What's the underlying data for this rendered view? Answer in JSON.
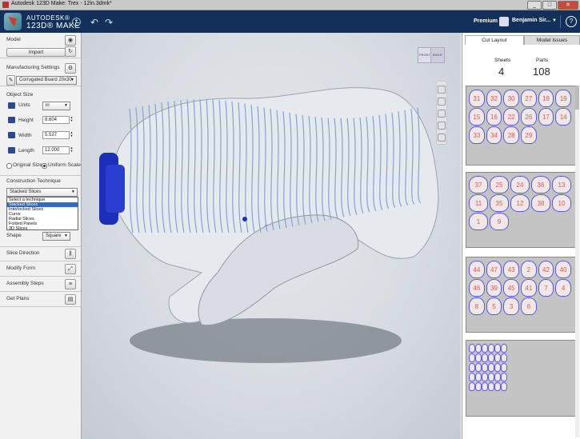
{
  "window": {
    "title": "Autodesk 123D Make: Trex - 12in.3dmk*",
    "buttons": [
      "_",
      "□",
      "✕"
    ]
  },
  "appbar": {
    "brand_line1": "AUTODESK®",
    "brand_line2": "123D® MAKE",
    "premium_label": "Premium",
    "user_name": "Benjamin Sir..."
  },
  "left_panel": {
    "model": {
      "header": "Model",
      "import_label": "Import"
    },
    "manufacturing": {
      "header": "Manufacturing Settings",
      "material": "Corrugated Board 20x30"
    },
    "object_size": {
      "header": "Object Size",
      "units_label": "Units",
      "units_value": "in",
      "height_label": "Height",
      "height_value": "8.604",
      "width_label": "Width",
      "width_value": "5.537",
      "length_label": "Length",
      "length_value": "12.000",
      "original_size": "Original Size",
      "uniform_scale": "Uniform Scale"
    },
    "construction": {
      "header": "Construction Technique",
      "selected": "Stacked Slices",
      "options": [
        "Select a technique",
        "Stacked Slices",
        "Interlocked Slices",
        "Curve",
        "Radial Slices",
        "Folded Panels",
        "3D Slices"
      ],
      "shape_label": "Shape",
      "shape_value": "Square"
    },
    "slice_direction": "Slice Direction",
    "modify_form": "Modify Form",
    "assembly_steps": "Assembly Steps",
    "get_plans": "Get Plans"
  },
  "viewport": {
    "navcube_front": "FRONT",
    "navcube_right": "RIGHT"
  },
  "right_panel": {
    "tabs": [
      "Cut Layout",
      "Model Issues"
    ],
    "sheets_label": "Sheets",
    "sheets_value": "4",
    "parts_label": "Parts",
    "parts_value": "108",
    "sheet1_labels": [
      "31",
      "32",
      "30",
      "27",
      "18",
      "19",
      "15",
      "16",
      "22",
      "26",
      "17",
      "14",
      "33",
      "34",
      "28",
      "29"
    ],
    "sheet2_labels": [
      "37",
      "25",
      "24",
      "36",
      "13",
      "11",
      "35",
      "12",
      "38",
      "10",
      "1",
      "9"
    ],
    "sheet3_labels": [
      "44",
      "47",
      "43",
      "2",
      "42",
      "40",
      "46",
      "39",
      "45",
      "41",
      "7",
      "4",
      "8",
      "5",
      "3",
      "6"
    ]
  },
  "colors": {
    "appbar_bg": "#12305a",
    "slice_color": "#eef0f4",
    "slice_edge": "#2a6fd6",
    "base_blue": "#1c2fb8",
    "part_label": "#e2565a"
  }
}
